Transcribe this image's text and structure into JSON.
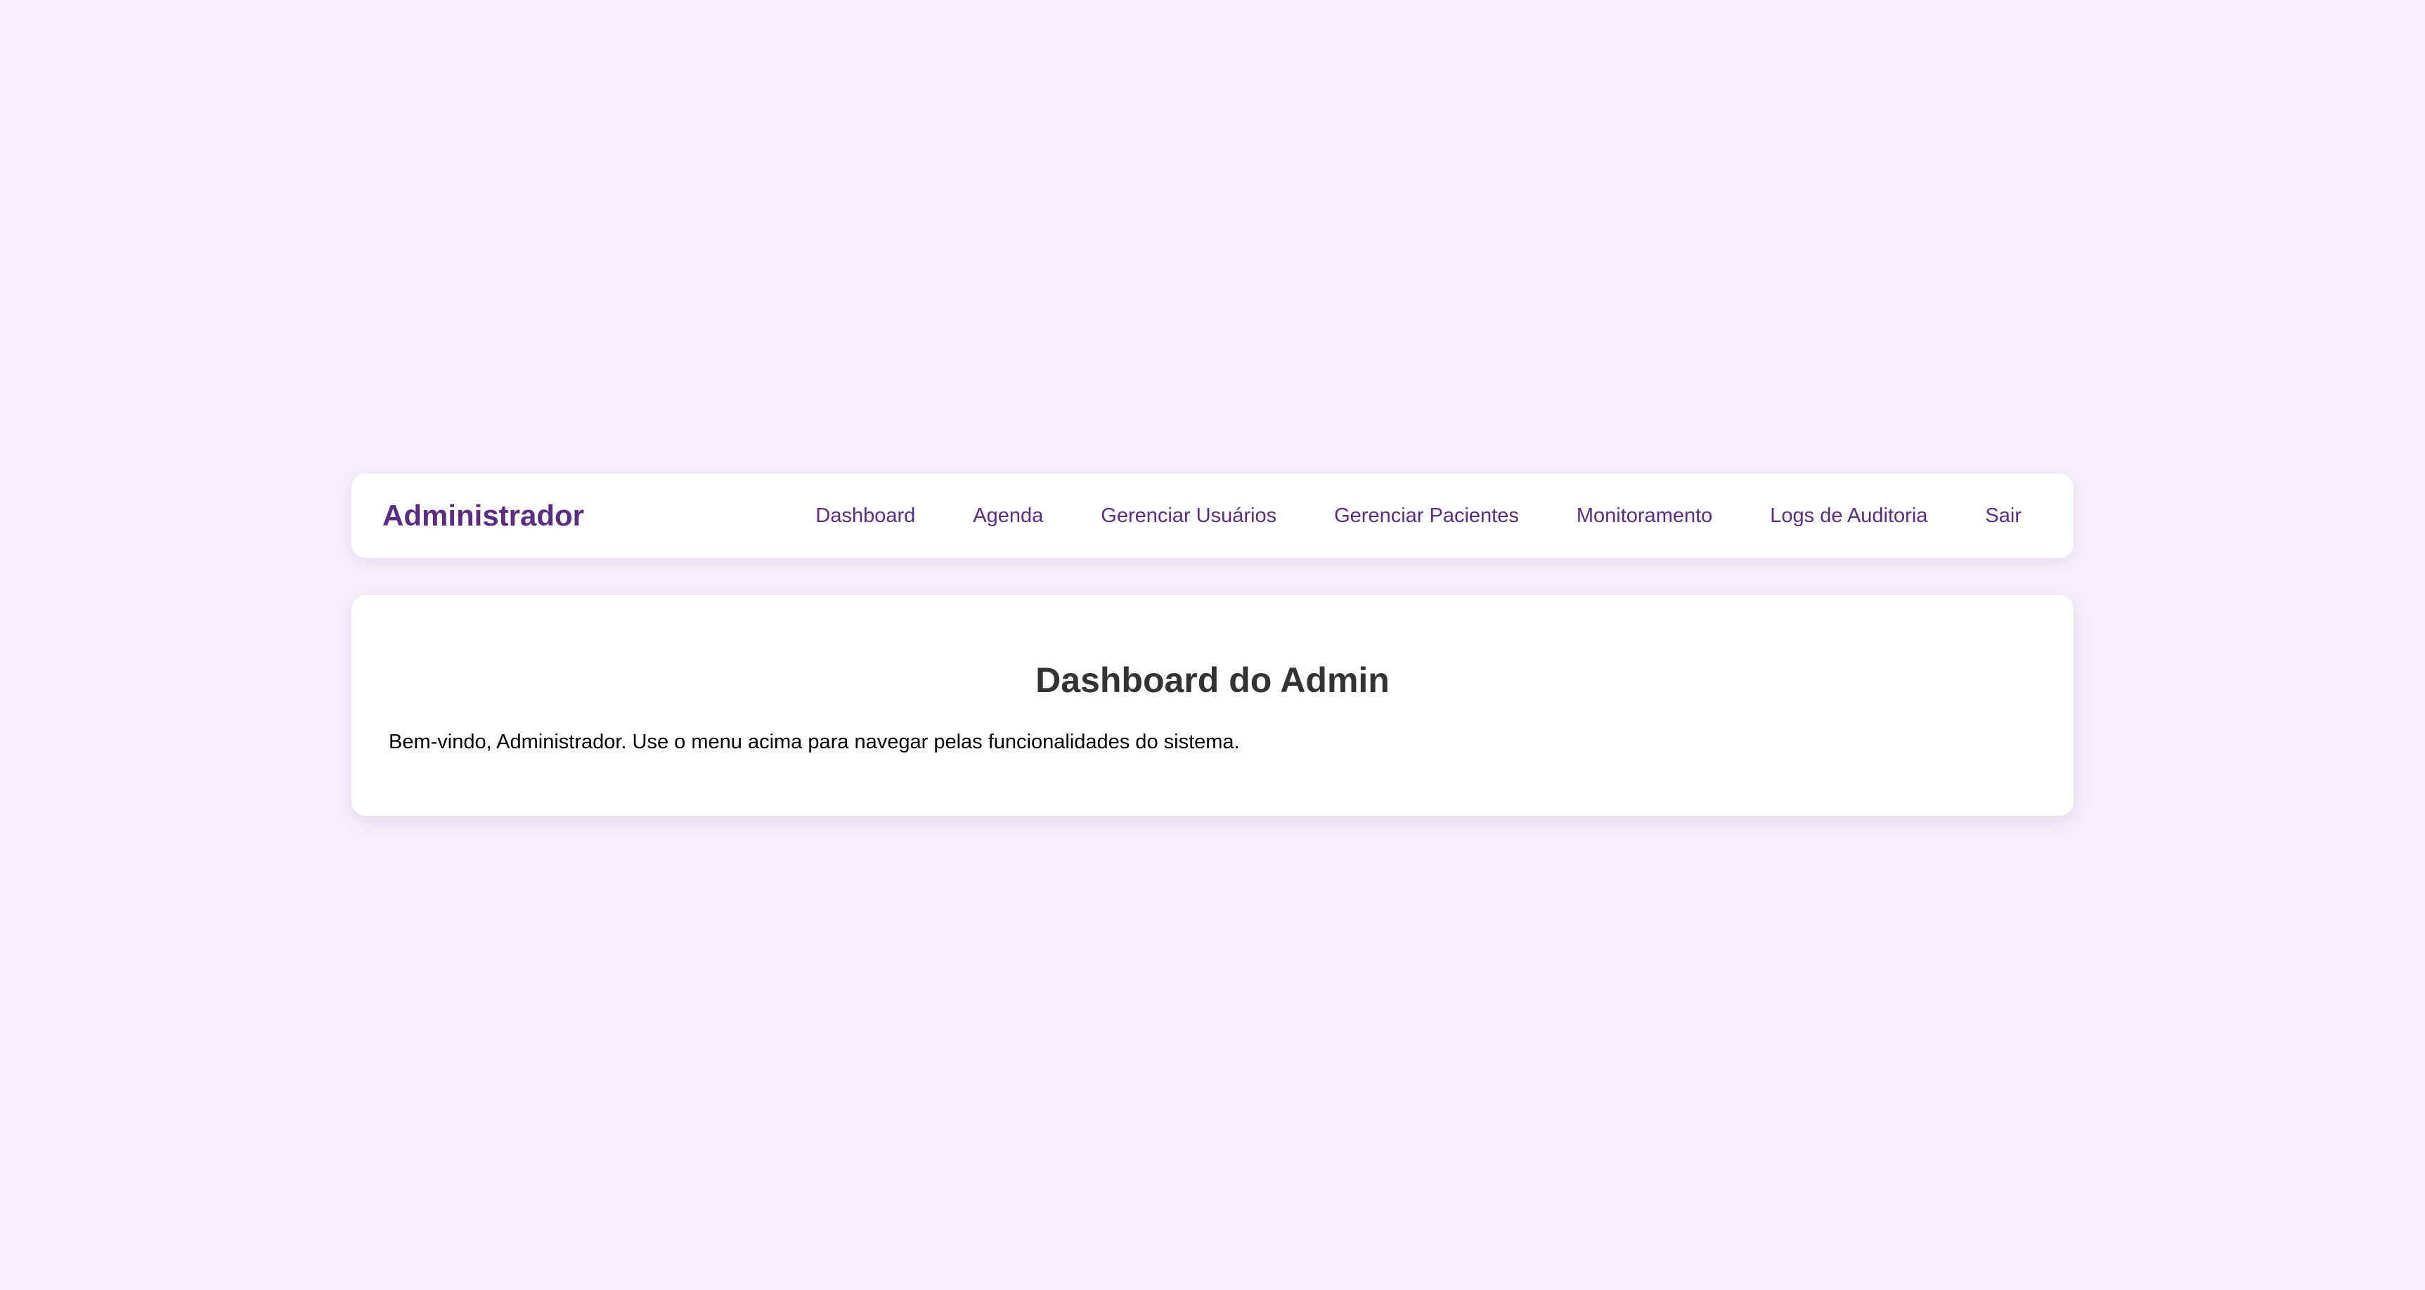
{
  "colors": {
    "background": "#f6effb",
    "brand": "#5a2d82",
    "heading": "#333333",
    "text": "#000000",
    "card": "#ffffff"
  },
  "navbar": {
    "brand": "Administrador",
    "links": [
      "Dashboard",
      "Agenda",
      "Gerenciar Usuários",
      "Gerenciar Pacientes",
      "Monitoramento",
      "Logs de Auditoria",
      "Sair"
    ]
  },
  "main": {
    "title": "Dashboard do Admin",
    "welcome": "Bem-vindo, Administrador. Use o menu acima para navegar pelas funcionalidades do sistema."
  }
}
